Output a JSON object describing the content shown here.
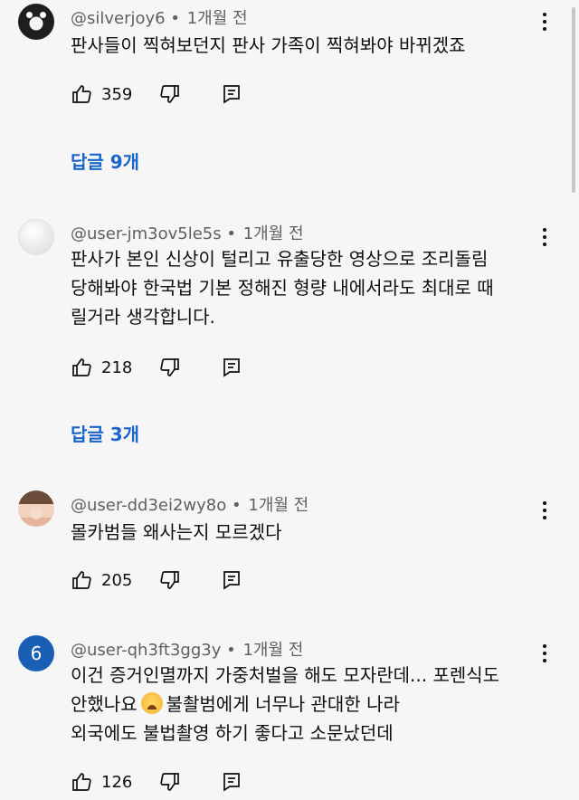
{
  "comments": [
    {
      "handle": "@silverjoy6",
      "time": "1개월 전",
      "lines": [
        "판사들이 찍혀보던지 판사 가족이 찍혀봐야 바뀌겠죠"
      ],
      "likes": "359",
      "replies": "답글 9개"
    },
    {
      "handle": "@user-jm3ov5le5s",
      "time": "1개월 전",
      "lines": [
        "판사가 본인 신상이 털리고 유출당한 영상으로 조리돌림",
        "당해봐야 한국법 기본 정해진 형량 내에서라도 최대로 때",
        "릴거라 생각합니다."
      ],
      "likes": "218",
      "replies": "답글 3개"
    },
    {
      "handle": "@user-dd3ei2wy8o",
      "time": "1개월 전",
      "lines": [
        "몰카범들 왜사는지 모르겠다"
      ],
      "likes": "205"
    },
    {
      "handle": "@user-qh3ft3gg3y",
      "time": "1개월 전",
      "avatar_letter": "6",
      "lines": [
        "이건 증거인멸까지 가중처벌을 해도 모자란데... 포렌식도",
        "불촬범에게 너무나 관대한 나라",
        "외국에도 불법촬영 하기 좋다고 소문났던데"
      ],
      "line2_prefix": "안했나요",
      "likes": "126"
    }
  ],
  "separator": "•",
  "icons": {
    "like": "thumbs-up-icon",
    "dislike": "thumbs-down-icon",
    "reply": "reply-icon",
    "more": "more-vertical-icon",
    "emoji": "tired-face-emoji"
  },
  "colors": {
    "background": "#f6f6f6",
    "link": "#1a65c9",
    "meta": "#606060",
    "avatar_blue": "#1a5fb4"
  }
}
